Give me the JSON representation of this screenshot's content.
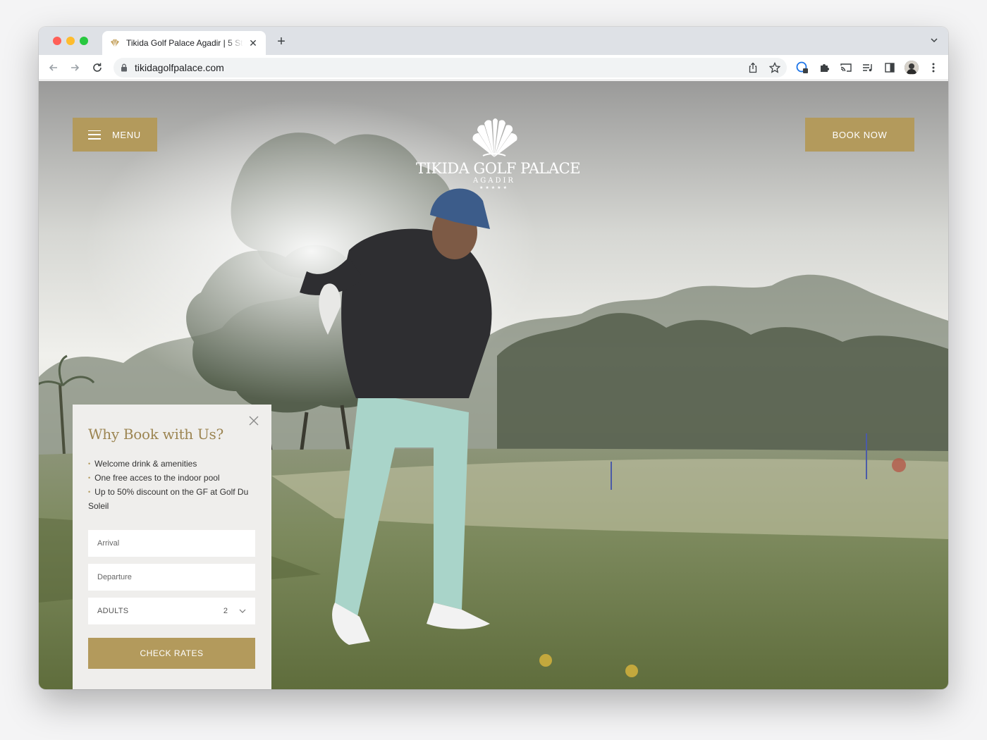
{
  "browser": {
    "tab_title": "Tikida Golf Palace Agadir | 5 St",
    "url": "tikidagolfpalace.com",
    "icons": {
      "back": "arrow-left-icon",
      "forward": "arrow-right-icon",
      "reload": "reload-icon",
      "lock": "lock-icon",
      "share": "share-icon",
      "bookmark": "star-icon",
      "extension": "puzzle-icon",
      "cast": "cast-icon",
      "media": "media-queue-icon",
      "side_panel": "side-panel-icon",
      "more": "kebab-menu-icon"
    }
  },
  "header": {
    "menu_label": "MENU",
    "book_label": "BOOK NOW",
    "logo_name": "TIKIDA GOLF PALACE",
    "logo_sub": "AGADIR",
    "logo_stars": "★★★★★"
  },
  "booking": {
    "title": "Why Book with Us?",
    "perks": [
      "Welcome drink & amenities",
      "One free acces to the indoor pool",
      "Up to 50% discount on the GF at Golf Du Soleil"
    ],
    "arrival_placeholder": "Arrival",
    "departure_placeholder": "Departure",
    "adults_label": "ADULTS",
    "adults_value": "2",
    "check_label": "CHECK RATES"
  },
  "colors": {
    "brand_gold": "#b39a5c",
    "title_gold": "#9c8552",
    "panel_bg": "#efeeec"
  }
}
